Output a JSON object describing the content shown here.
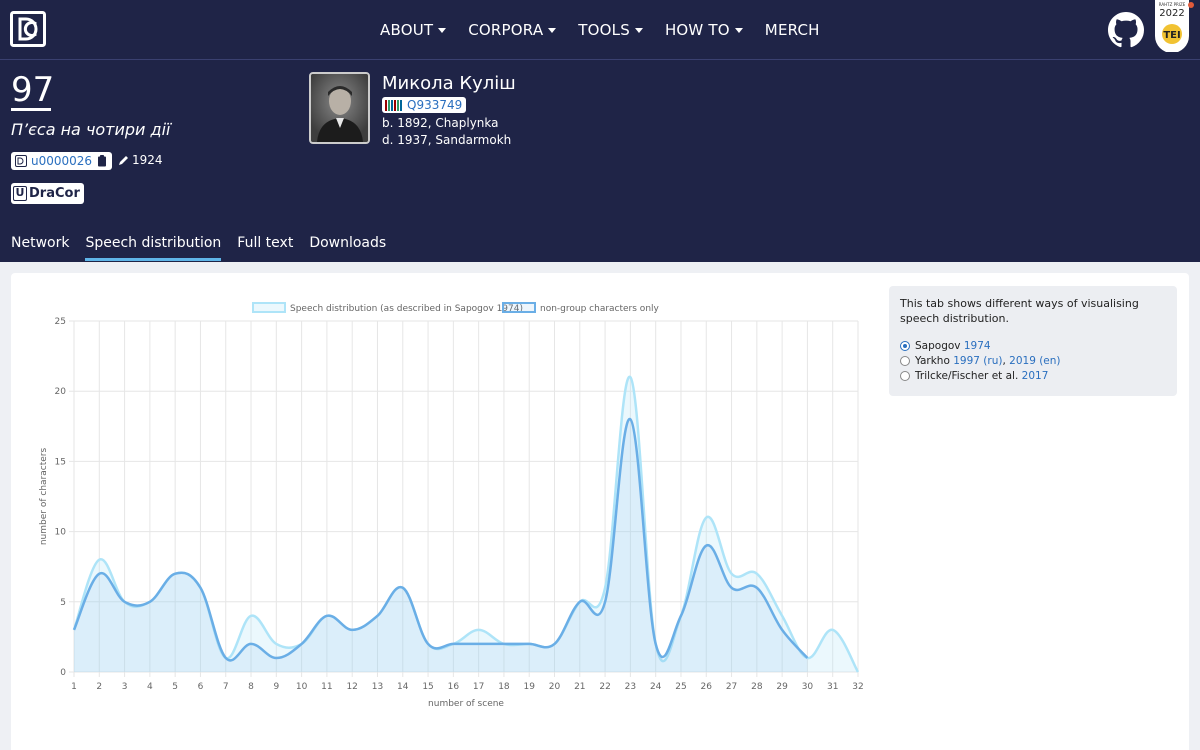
{
  "nav": {
    "items": [
      {
        "label": "ABOUT",
        "dropdown": true
      },
      {
        "label": "CORPORA",
        "dropdown": true
      },
      {
        "label": "TOOLS",
        "dropdown": true
      },
      {
        "label": "HOW TO",
        "dropdown": true
      },
      {
        "label": "MERCH",
        "dropdown": false
      }
    ],
    "tei_badge": {
      "line1": "RAHTZ PRIZE",
      "year": "2022",
      "label": "TEI"
    }
  },
  "play": {
    "number": "97",
    "subtitle": "П’єса на чотири дії",
    "id": "u0000026",
    "year": "1924",
    "corpus": "DraCor",
    "corpus_prefix": "U"
  },
  "author": {
    "name": "Микола Куліш",
    "wikidata": "Q933749",
    "born": "b. 1892, Chaplynka",
    "died": "d. 1937, Sandarmokh"
  },
  "tabs": [
    "Network",
    "Speech distribution",
    "Full text",
    "Downloads"
  ],
  "active_tab": 1,
  "panel": {
    "description": "This tab shows different ways of visualising speech distribution.",
    "options": [
      {
        "name": "Sapogov",
        "links": [
          "1974"
        ],
        "checked": true
      },
      {
        "name": "Yarkho",
        "links": [
          "1997 (ru)",
          "2019 (en)"
        ],
        "checked": false
      },
      {
        "name": "Trilcke/Fischer et al.",
        "links": [
          "2017"
        ],
        "checked": false
      }
    ]
  },
  "colors": {
    "navy": "#1f2447",
    "series1": "#aee4f8",
    "series2": "#6aaee6",
    "link": "#2a6fbf"
  },
  "chart_data": {
    "type": "line",
    "xlabel": "number of scene",
    "ylabel": "number of characters",
    "x": [
      1,
      2,
      3,
      4,
      5,
      6,
      7,
      8,
      9,
      10,
      11,
      12,
      13,
      14,
      15,
      16,
      17,
      18,
      19,
      20,
      21,
      22,
      23,
      24,
      25,
      26,
      27,
      28,
      29,
      30,
      31,
      32
    ],
    "ylim": [
      0,
      25
    ],
    "yticks": [
      0,
      5,
      10,
      15,
      20,
      25
    ],
    "legend_position": "top",
    "grid": true,
    "series": [
      {
        "name": "Speech distribution (as described in Sapogov 1974)",
        "values": [
          3,
          8,
          5,
          5,
          7,
          6,
          1,
          4,
          2,
          2,
          4,
          3,
          4,
          6,
          2,
          2,
          3,
          2,
          2,
          2,
          5,
          6,
          21,
          2,
          4,
          11,
          7,
          7,
          4,
          1,
          3,
          0
        ]
      },
      {
        "name": "non-group characters only",
        "values": [
          3,
          7,
          5,
          5,
          7,
          6,
          1,
          2,
          1,
          2,
          4,
          3,
          4,
          6,
          2,
          2,
          2,
          2,
          2,
          2,
          5,
          5,
          18,
          2,
          4,
          9,
          6,
          6,
          3,
          1,
          null,
          null
        ]
      }
    ]
  }
}
